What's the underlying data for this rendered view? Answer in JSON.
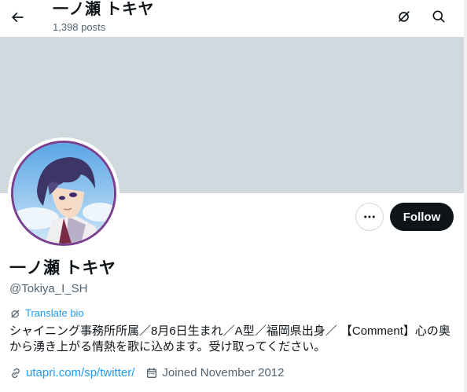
{
  "header": {
    "title": "一ノ瀬 トキヤ",
    "post_count": "1,398 posts"
  },
  "profile": {
    "display_name": "一ノ瀬 トキヤ",
    "handle": "@Tokiya_I_SH",
    "translate_label": "Translate bio",
    "bio_line1": "シャイニング事務所所属／8月6日生まれ／A型／福岡県出身／ 【Comment】心の奥",
    "bio_line2": "から湧き上がる情熱を歌に込めます。受け取ってください。",
    "website": "utapri.com/sp/twitter/",
    "joined": "Joined November 2012"
  },
  "buttons": {
    "follow": "Follow"
  },
  "colors": {
    "banner": "#cfd9de",
    "accent": "#1d9bf0",
    "follow_bg": "#0f1419",
    "secondary_text": "#536471",
    "avatar_ring": "#7b3f8f"
  },
  "icons": {
    "back": "arrow-left-icon",
    "grok": "grok-icon",
    "search": "search-icon",
    "more": "more-icon",
    "translate": "grok-icon",
    "link": "link-icon",
    "calendar": "calendar-icon"
  }
}
